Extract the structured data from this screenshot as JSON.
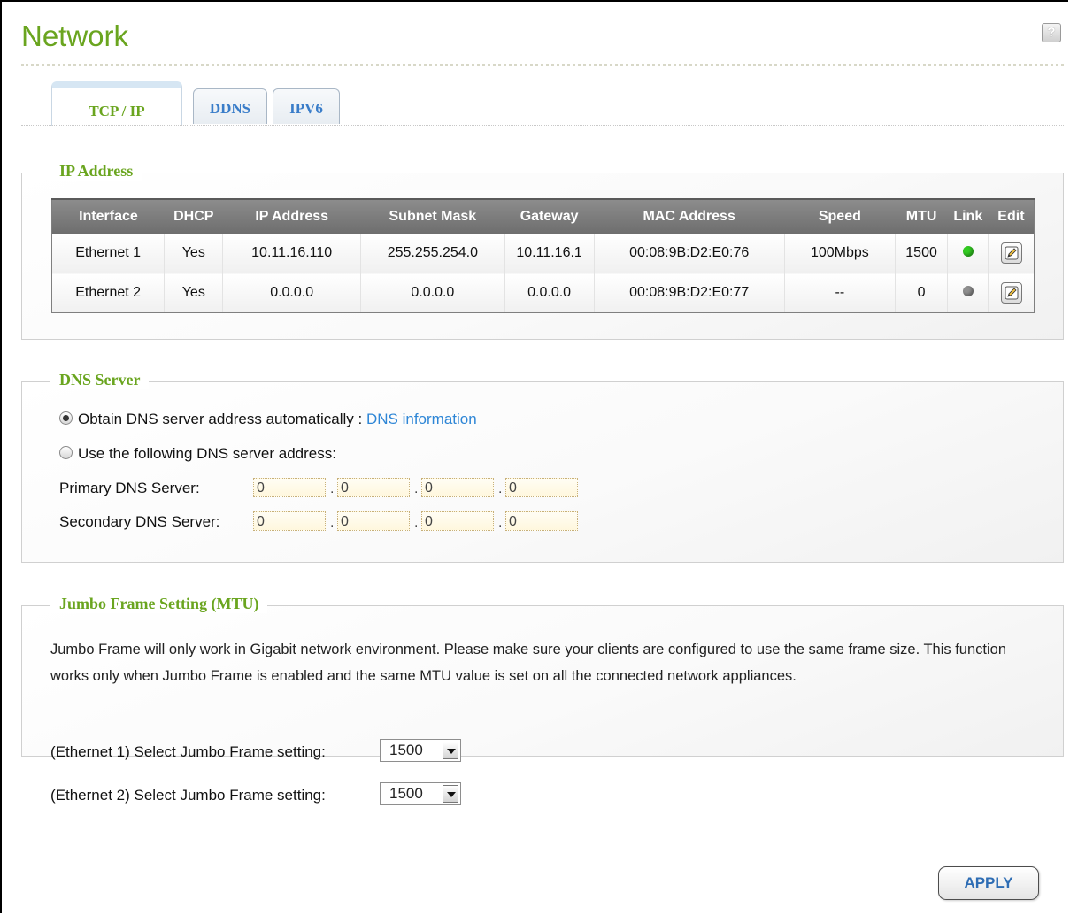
{
  "page": {
    "title": "Network",
    "help_icon": "?"
  },
  "tabs": [
    {
      "label": "TCP / IP",
      "active": true
    },
    {
      "label": "DDNS",
      "active": false
    },
    {
      "label": "IPV6",
      "active": false
    }
  ],
  "ip_address": {
    "legend": "IP Address",
    "columns": [
      "Interface",
      "DHCP",
      "IP Address",
      "Subnet Mask",
      "Gateway",
      "MAC Address",
      "Speed",
      "MTU",
      "Link",
      "Edit"
    ],
    "rows": [
      {
        "interface": "Ethernet 1",
        "dhcp": "Yes",
        "ip": "10.11.16.110",
        "mask": "255.255.254.0",
        "gateway": "10.11.16.1",
        "mac": "00:08:9B:D2:E0:76",
        "speed": "100Mbps",
        "mtu": "1500",
        "link_color": "#33cc22"
      },
      {
        "interface": "Ethernet 2",
        "dhcp": "Yes",
        "ip": "0.0.0.0",
        "mask": "0.0.0.0",
        "gateway": "0.0.0.0",
        "mac": "00:08:9B:D2:E0:77",
        "speed": "--",
        "mtu": "0",
        "link_color": "#8f8f8f"
      }
    ]
  },
  "dns": {
    "legend": "DNS Server",
    "auto_label": "Obtain DNS server address automatically :",
    "auto_link": "DNS information",
    "manual_label": "Use the following DNS server address:",
    "primary_label": "Primary DNS Server:",
    "secondary_label": "Secondary DNS Server:",
    "primary": [
      "0",
      "0",
      "0",
      "0"
    ],
    "secondary": [
      "0",
      "0",
      "0",
      "0"
    ],
    "dot": "."
  },
  "jumbo": {
    "legend": "Jumbo Frame Setting (MTU)",
    "description": "Jumbo Frame will only work in Gigabit network environment. Please make sure your clients are configured to use the same frame size. This function works only when Jumbo Frame is enabled and the same MTU value is set on all the connected network appliances.",
    "eth1_label": "(Ethernet 1) Select Jumbo Frame setting:",
    "eth1_value": "1500",
    "eth2_label": "(Ethernet 2) Select Jumbo Frame setting:",
    "eth2_value": "1500"
  },
  "apply_label": "APPLY"
}
